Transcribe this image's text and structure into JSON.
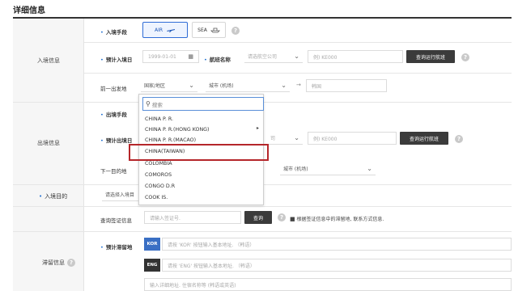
{
  "title": "详细信息",
  "sections": {
    "entry": "入境信息",
    "exit": "出境信息",
    "purpose": "入境目的",
    "stay": "滞留信息"
  },
  "entry": {
    "transport_label": "入境手段",
    "air_label": "AIR",
    "sea_label": "SEA",
    "date_label": "预计入境日",
    "date_value": "1999-01-01",
    "flight_label": "航班名称",
    "airline_placeholder": "请选航空公司",
    "flight_placeholder": "例) KE000",
    "search_button": "查询运行航班",
    "depart_label": "前一出发地",
    "country_select": "国家/地区",
    "city_select": "城市 (机场)",
    "to_arrow": "→",
    "seoul": "韩国"
  },
  "exit": {
    "transport_label": "出境手段",
    "date_label": "预计出境日",
    "airline_placeholder": "司",
    "flight_placeholder": "例) KE000",
    "search_button": "查询运行航班",
    "next_label": "下一目的地",
    "city_select": "城市 (机场)"
  },
  "purpose": {
    "placeholder": "请选择入境目"
  },
  "visa": {
    "label": "查询签证信息",
    "placeholder": "请输入签证号.",
    "button": "查询",
    "note": "根据签证信息中的滞留地, 联系方式信息."
  },
  "stay": {
    "addr_label": "预计滞留地",
    "kor_badge": "KOR",
    "kor_placeholder": "请按 'KOR' 按钮输入基本地址. （韩语）",
    "eng_badge": "ENG",
    "eng_placeholder": "请按 'ENG' 按钮输入基本地址. （韩语）",
    "detail_placeholder": "输入详细地址. 住宿名称等 (韩语或英语)"
  },
  "dropdown": {
    "search_placeholder": "搜索",
    "items": [
      "CHINA P. R.",
      "CHINA P. R.(HONG KONG)",
      "CHINA P. R.(MACAO)",
      "CHINA(TAIWAN)",
      "COLOMBIA",
      "COMOROS",
      "CONGO D.R",
      "COOK IS."
    ],
    "highlight_index": 3
  },
  "colors": {
    "accent_blue": "#2f6cd6",
    "highlight_red": "#b5262a",
    "dark_button": "#3b3b3b"
  }
}
